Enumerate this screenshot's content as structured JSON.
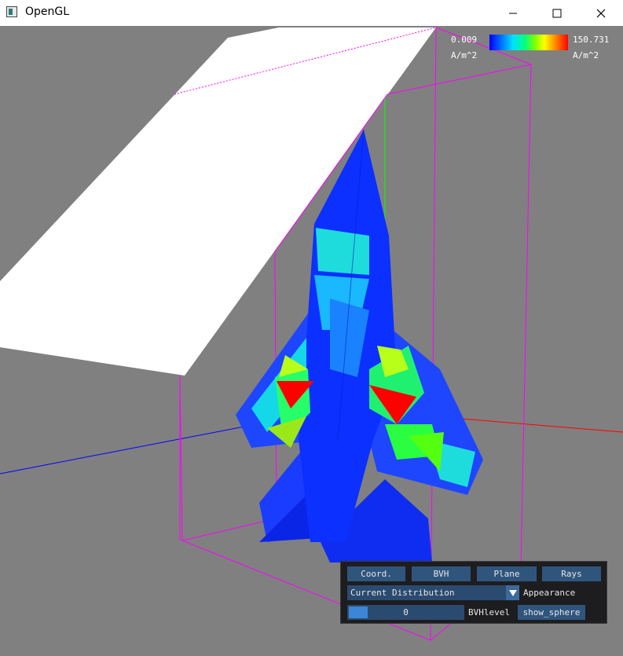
{
  "window": {
    "title": "OpenGL"
  },
  "legend": {
    "min_value": "0.009",
    "max_value": "150.731",
    "min_unit": "A/m^2",
    "max_unit": "A/m^2"
  },
  "panel": {
    "buttons": [
      "Coord.",
      "BVH",
      "Plane",
      "Rays"
    ],
    "distribution": {
      "selected": "Current Distribution",
      "label": "Appearance"
    },
    "bvh_slider": {
      "value": "0",
      "label": "BVHlevel"
    },
    "show_sphere_button": "show_sphere"
  },
  "colors": {
    "background": "#808080",
    "bounding_box": "#ff00ff",
    "axis_x": "#ff0000",
    "axis_y": "#00ff00",
    "axis_z": "#0000ff",
    "panel_bg": "#1d1d1f",
    "button": "#2f557d"
  },
  "icons": [
    "app-icon",
    "minimize-icon",
    "maximize-icon",
    "close-icon",
    "dropdown-arrow-icon"
  ]
}
